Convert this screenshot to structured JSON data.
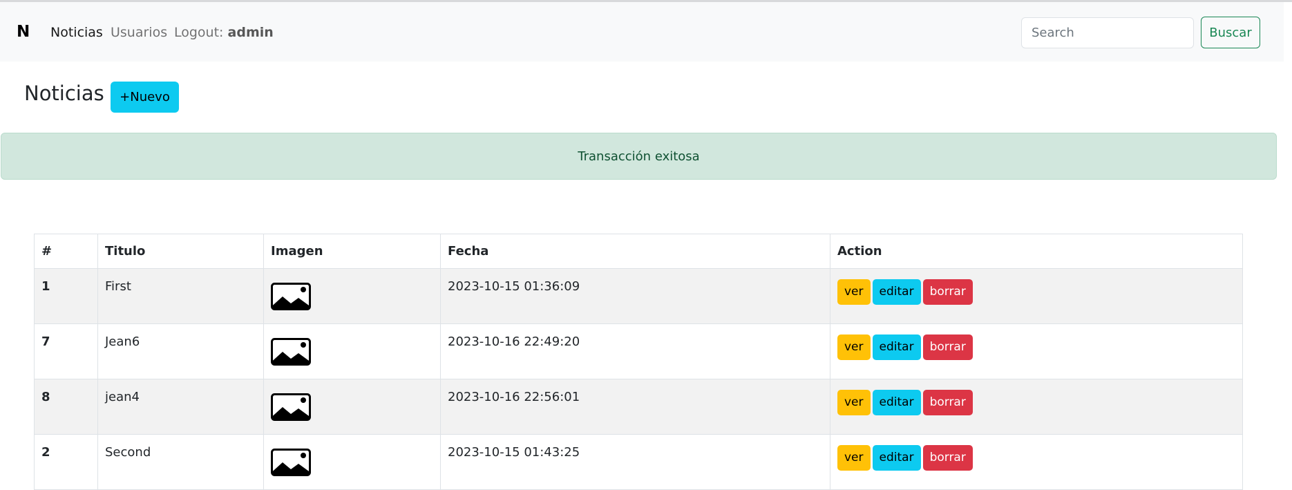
{
  "navbar": {
    "brand": "N",
    "links": [
      {
        "label": "Noticias"
      },
      {
        "label": "Usuarios"
      }
    ],
    "logout_label": "Logout:",
    "logout_user": "admin",
    "search_placeholder": "Search",
    "search_button": "Buscar"
  },
  "header": {
    "title": "Noticias",
    "new_button": "+Nuevo"
  },
  "alert": {
    "message": "Transacción exitosa"
  },
  "table": {
    "columns": [
      "#",
      "Titulo",
      "Imagen",
      "Fecha",
      "Action"
    ],
    "rows": [
      {
        "id": "1",
        "titulo": "First",
        "fecha": "2023-10-15 01:36:09"
      },
      {
        "id": "7",
        "titulo": "Jean6",
        "fecha": "2023-10-16 22:49:20"
      },
      {
        "id": "8",
        "titulo": "jean4",
        "fecha": "2023-10-16 22:56:01"
      },
      {
        "id": "2",
        "titulo": "Second",
        "fecha": "2023-10-15 01:43:25"
      }
    ],
    "actions": {
      "ver": "ver",
      "editar": "editar",
      "borrar": "borrar"
    }
  },
  "icons": {
    "image_placeholder": "image-icon"
  },
  "colors": {
    "navbar_bg": "#f8f9fa",
    "success_outline": "#198754",
    "info": "#0dcaf0",
    "warning": "#ffc107",
    "danger": "#dc3545",
    "alert_bg": "#d1e7dd",
    "alert_text": "#0f5132"
  }
}
